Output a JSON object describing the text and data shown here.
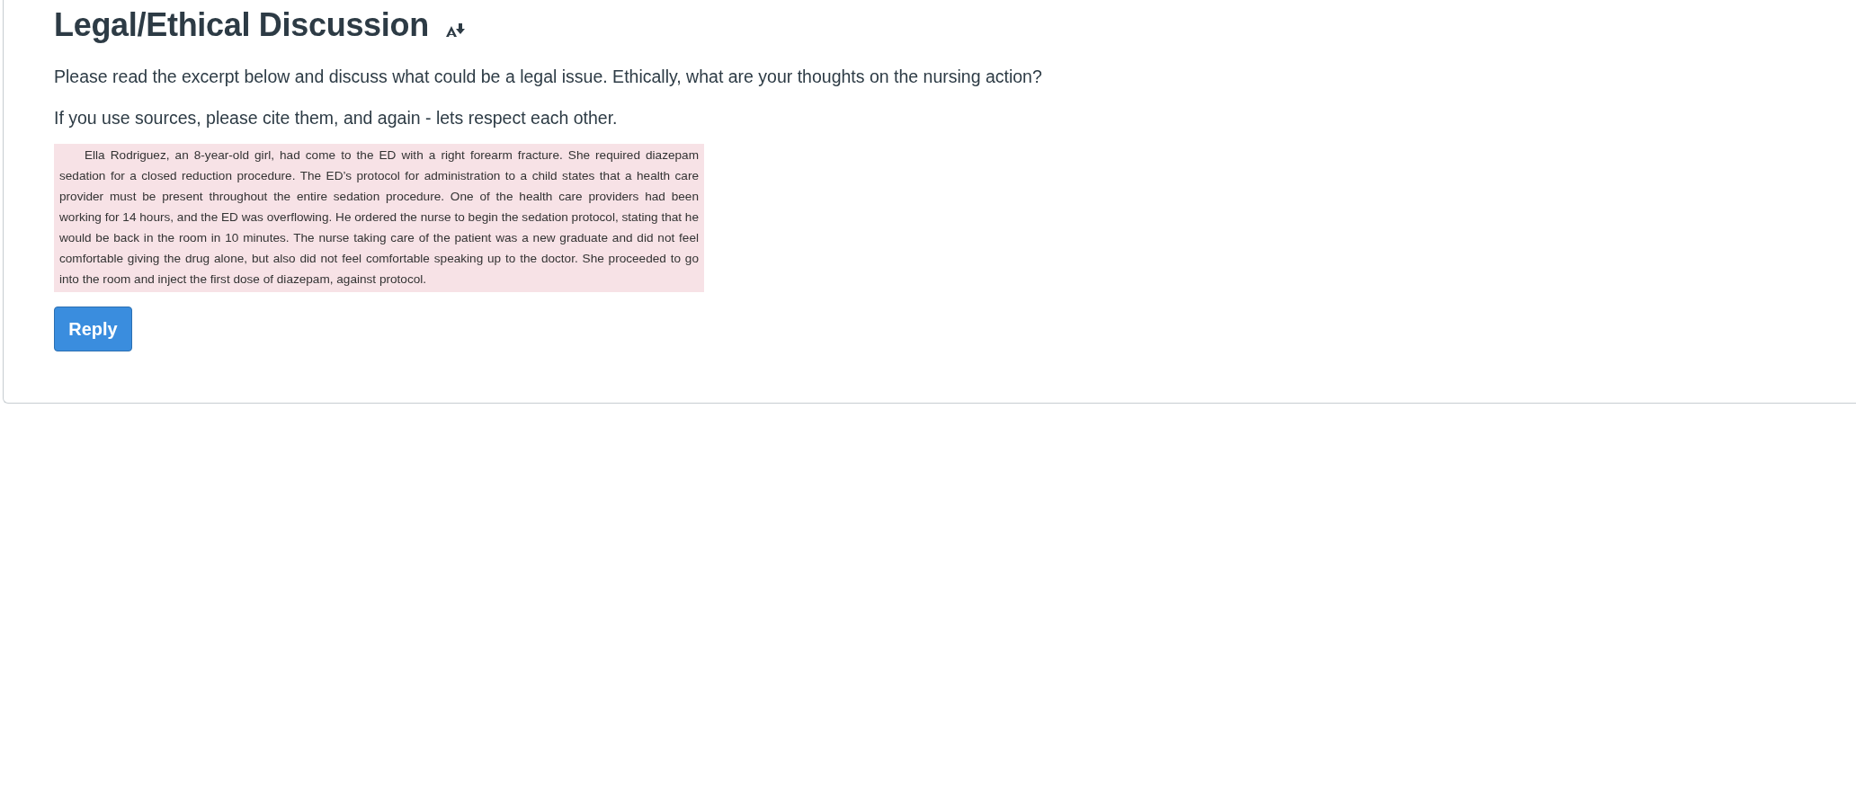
{
  "title": "Legal/Ethical Discussion",
  "paragraphs": [
    "Please read the excerpt below and discuss what could be a legal issue. Ethically, what are your thoughts on the nursing action?",
    "If you use sources, please cite them, and again - lets respect each other."
  ],
  "excerpt": "Ella Rodriguez, an 8-year-old girl, had come to the ED with a right forearm fracture. She required diazepam sedation for a closed reduction procedure. The ED’s protocol for administration to a child states that a health care provider must be present throughout the entire sedation procedure. One of the health care providers had been working for 14 hours, and the ED was overflowing. He ordered the nurse to begin the sedation protocol, stating that he would be back in the room in 10 minutes. The nurse taking care of the patient was a new graduate and did not feel comfortable giving the drug alone, but also did not feel comfortable speaking up to the doctor. She proceeded to go into the room and inject the first dose of diazepam, against protocol.",
  "reply_button": "Reply"
}
